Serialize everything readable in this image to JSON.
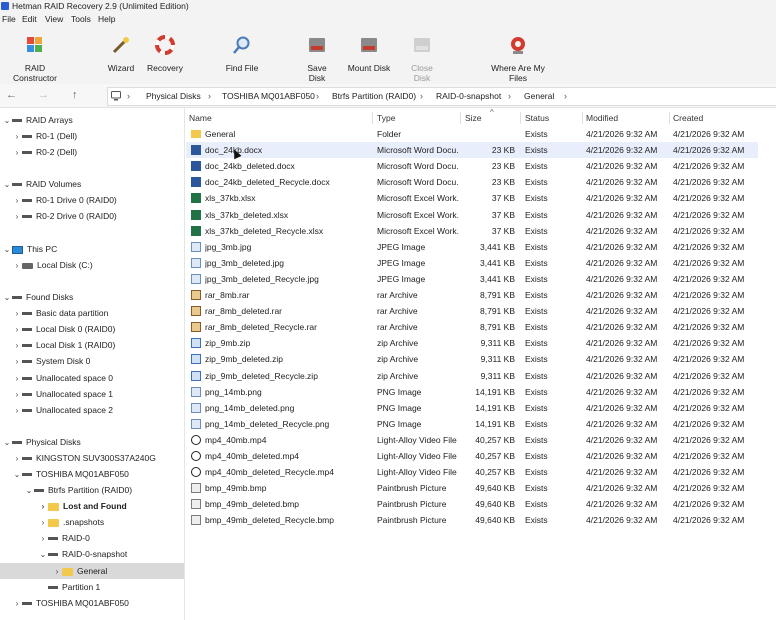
{
  "window": {
    "title": "Hetman RAID Recovery 2.9 (Unlimited Edition)"
  },
  "menu": [
    "File",
    "Edit",
    "View",
    "Tools",
    "Help"
  ],
  "toolbar": [
    {
      "label": "RAID Constructor",
      "icon": "puzzle-icon",
      "enabled": true
    },
    {
      "label": "Wizard",
      "icon": "wand-icon",
      "enabled": true
    },
    {
      "label": "Recovery",
      "icon": "lifebuoy-icon",
      "enabled": true
    },
    {
      "label": "Find File",
      "icon": "search-icon",
      "enabled": true
    },
    {
      "label": "Save Disk",
      "icon": "save-disk-icon",
      "enabled": true
    },
    {
      "label": "Mount Disk",
      "icon": "mount-disk-icon",
      "enabled": true
    },
    {
      "label": "Close Disk",
      "icon": "close-disk-icon",
      "enabled": false
    },
    {
      "label": "Where Are My Files",
      "icon": "help-lifebuoy-icon",
      "enabled": true
    }
  ],
  "nav": {
    "back": "←",
    "forward": "→",
    "up": "↑"
  },
  "breadcrumb": [
    "Physical Disks",
    "TOSHIBA MQ01ABF050",
    "Btrfs Partition (RAID0)",
    "RAID-0-snapshot",
    "General"
  ],
  "tree": [
    {
      "label": "RAID Arrays",
      "bold": false
    },
    {
      "label": "R0-1 (Dell)"
    },
    {
      "label": "R0-2 (Dell)"
    },
    {
      "label": "RAID Volumes"
    },
    {
      "label": "R0-1 Drive 0 (RAID0)"
    },
    {
      "label": "R0-2 Drive 0 (RAID0)"
    },
    {
      "label": "This PC"
    },
    {
      "label": "Local Disk (C:)"
    },
    {
      "label": "Found Disks"
    },
    {
      "label": "Basic data partition"
    },
    {
      "label": "Local Disk 0 (RAID0)"
    },
    {
      "label": "Local Disk 1 (RAID0)"
    },
    {
      "label": "System Disk 0"
    },
    {
      "label": "Unallocated space 0"
    },
    {
      "label": "Unallocated space 1"
    },
    {
      "label": "Unallocated space 2"
    },
    {
      "label": "Physical Disks"
    },
    {
      "label": "KINGSTON SUV300S37A240G"
    },
    {
      "label": "TOSHIBA MQ01ABF050"
    },
    {
      "label": "Btrfs Partition (RAID0)"
    },
    {
      "label": "Lost and Found"
    },
    {
      "label": ".snapshots"
    },
    {
      "label": "RAID-0"
    },
    {
      "label": "RAID-0-snapshot"
    },
    {
      "label": "General"
    },
    {
      "label": "Partition 1"
    },
    {
      "label": "TOSHIBA MQ01ABF050"
    }
  ],
  "columns": [
    "Name",
    "Type",
    "Size",
    "Status",
    "Modified",
    "Created"
  ],
  "files": [
    {
      "name": "General",
      "type": "Folder",
      "size": "",
      "status": "Exists",
      "modified": "4/21/2026 9:32 AM",
      "created": "4/21/2026 9:32 AM",
      "icon": "folder"
    },
    {
      "name": "doc_24kb.docx",
      "type": "Microsoft Word Docu...",
      "size": "23 KB",
      "status": "Exists",
      "modified": "4/21/2026 9:32 AM",
      "created": "4/21/2026 9:32 AM",
      "icon": "word"
    },
    {
      "name": "doc_24kb_deleted.docx",
      "type": "Microsoft Word Docu...",
      "size": "23 KB",
      "status": "Exists",
      "modified": "4/21/2026 9:32 AM",
      "created": "4/21/2026 9:32 AM",
      "icon": "word"
    },
    {
      "name": "doc_24kb_deleted_Recycle.docx",
      "type": "Microsoft Word Docu...",
      "size": "23 KB",
      "status": "Exists",
      "modified": "4/21/2026 9:32 AM",
      "created": "4/21/2026 9:32 AM",
      "icon": "word"
    },
    {
      "name": "xls_37kb.xlsx",
      "type": "Microsoft Excel Work...",
      "size": "37 KB",
      "status": "Exists",
      "modified": "4/21/2026 9:32 AM",
      "created": "4/21/2026 9:32 AM",
      "icon": "excel"
    },
    {
      "name": "xls_37kb_deleted.xlsx",
      "type": "Microsoft Excel Work...",
      "size": "37 KB",
      "status": "Exists",
      "modified": "4/21/2026 9:32 AM",
      "created": "4/21/2026 9:32 AM",
      "icon": "excel"
    },
    {
      "name": "xls_37kb_deleted_Recycle.xlsx",
      "type": "Microsoft Excel Work...",
      "size": "37 KB",
      "status": "Exists",
      "modified": "4/21/2026 9:32 AM",
      "created": "4/21/2026 9:32 AM",
      "icon": "excel"
    },
    {
      "name": "jpg_3mb.jpg",
      "type": "JPEG Image",
      "size": "3,441 KB",
      "status": "Exists",
      "modified": "4/21/2026 9:32 AM",
      "created": "4/21/2026 9:32 AM",
      "icon": "img"
    },
    {
      "name": "jpg_3mb_deleted.jpg",
      "type": "JPEG Image",
      "size": "3,441 KB",
      "status": "Exists",
      "modified": "4/21/2026 9:32 AM",
      "created": "4/21/2026 9:32 AM",
      "icon": "img"
    },
    {
      "name": "jpg_3mb_deleted_Recycle.jpg",
      "type": "JPEG Image",
      "size": "3,441 KB",
      "status": "Exists",
      "modified": "4/21/2026 9:32 AM",
      "created": "4/21/2026 9:32 AM",
      "icon": "img"
    },
    {
      "name": "rar_8mb.rar",
      "type": "rar Archive",
      "size": "8,791 KB",
      "status": "Exists",
      "modified": "4/21/2026 9:32 AM",
      "created": "4/21/2026 9:32 AM",
      "icon": "rar"
    },
    {
      "name": "rar_8mb_deleted.rar",
      "type": "rar Archive",
      "size": "8,791 KB",
      "status": "Exists",
      "modified": "4/21/2026 9:32 AM",
      "created": "4/21/2026 9:32 AM",
      "icon": "rar"
    },
    {
      "name": "rar_8mb_deleted_Recycle.rar",
      "type": "rar Archive",
      "size": "8,791 KB",
      "status": "Exists",
      "modified": "4/21/2026 9:32 AM",
      "created": "4/21/2026 9:32 AM",
      "icon": "rar"
    },
    {
      "name": "zip_9mb.zip",
      "type": "zip Archive",
      "size": "9,311 KB",
      "status": "Exists",
      "modified": "4/21/2026 9:32 AM",
      "created": "4/21/2026 9:32 AM",
      "icon": "zip"
    },
    {
      "name": "zip_9mb_deleted.zip",
      "type": "zip Archive",
      "size": "9,311 KB",
      "status": "Exists",
      "modified": "4/21/2026 9:32 AM",
      "created": "4/21/2026 9:32 AM",
      "icon": "zip"
    },
    {
      "name": "zip_9mb_deleted_Recycle.zip",
      "type": "zip Archive",
      "size": "9,311 KB",
      "status": "Exists",
      "modified": "4/21/2026 9:32 AM",
      "created": "4/21/2026 9:32 AM",
      "icon": "zip"
    },
    {
      "name": "png_14mb.png",
      "type": "PNG Image",
      "size": "14,191 KB",
      "status": "Exists",
      "modified": "4/21/2026 9:32 AM",
      "created": "4/21/2026 9:32 AM",
      "icon": "img"
    },
    {
      "name": "png_14mb_deleted.png",
      "type": "PNG Image",
      "size": "14,191 KB",
      "status": "Exists",
      "modified": "4/21/2026 9:32 AM",
      "created": "4/21/2026 9:32 AM",
      "icon": "img"
    },
    {
      "name": "png_14mb_deleted_Recycle.png",
      "type": "PNG Image",
      "size": "14,191 KB",
      "status": "Exists",
      "modified": "4/21/2026 9:32 AM",
      "created": "4/21/2026 9:32 AM",
      "icon": "img"
    },
    {
      "name": "mp4_40mb.mp4",
      "type": "Light-Alloy Video File",
      "size": "40,257 KB",
      "status": "Exists",
      "modified": "4/21/2026 9:32 AM",
      "created": "4/21/2026 9:32 AM",
      "icon": "video"
    },
    {
      "name": "mp4_40mb_deleted.mp4",
      "type": "Light-Alloy Video File",
      "size": "40,257 KB",
      "status": "Exists",
      "modified": "4/21/2026 9:32 AM",
      "created": "4/21/2026 9:32 AM",
      "icon": "video"
    },
    {
      "name": "mp4_40mb_deleted_Recycle.mp4",
      "type": "Light-Alloy Video File",
      "size": "40,257 KB",
      "status": "Exists",
      "modified": "4/21/2026 9:32 AM",
      "created": "4/21/2026 9:32 AM",
      "icon": "video"
    },
    {
      "name": "bmp_49mb.bmp",
      "type": "Paintbrush Picture",
      "size": "49,640 KB",
      "status": "Exists",
      "modified": "4/21/2026 9:32 AM",
      "created": "4/21/2026 9:32 AM",
      "icon": "bmp"
    },
    {
      "name": "bmp_49mb_deleted.bmp",
      "type": "Paintbrush Picture",
      "size": "49,640 KB",
      "status": "Exists",
      "modified": "4/21/2026 9:32 AM",
      "created": "4/21/2026 9:32 AM",
      "icon": "bmp"
    },
    {
      "name": "bmp_49mb_deleted_Recycle.bmp",
      "type": "Paintbrush Picture",
      "size": "49,640 KB",
      "status": "Exists",
      "modified": "4/21/2026 9:32 AM",
      "created": "4/21/2026 9:32 AM",
      "icon": "bmp"
    }
  ]
}
